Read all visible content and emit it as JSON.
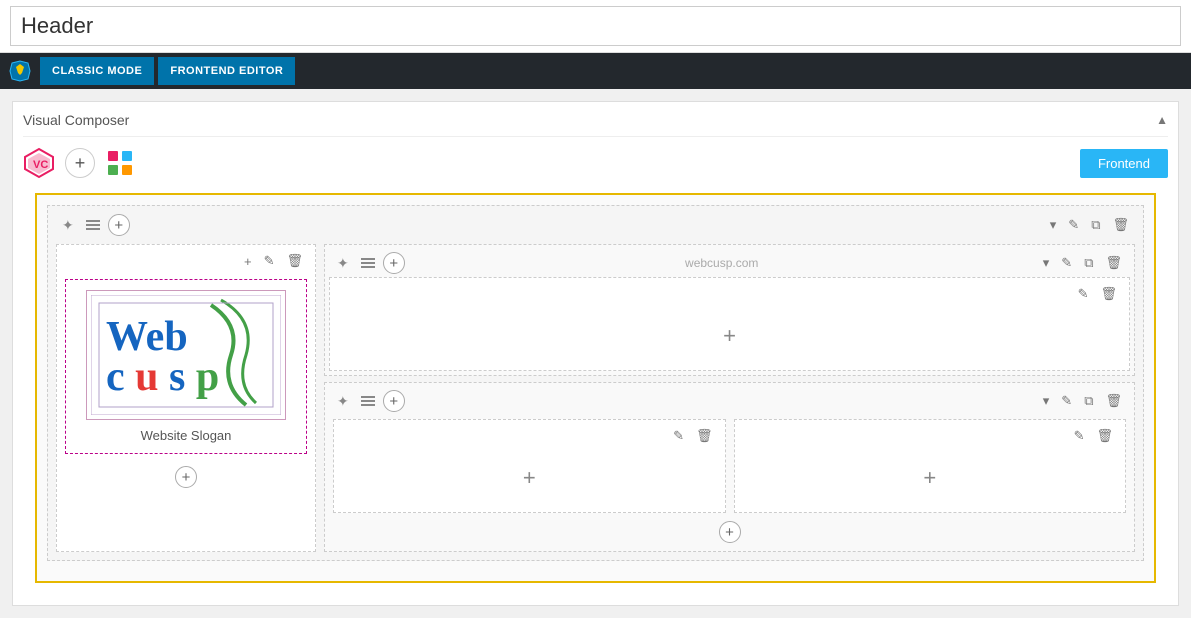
{
  "top_bar": {
    "title_value": "Header",
    "title_placeholder": "Header"
  },
  "nav": {
    "classic_mode_label": "CLASSIC MODE",
    "frontend_editor_label": "FRONTEND EDITOR"
  },
  "vc_section": {
    "title": "Visual Composer",
    "collapse_arrow": "▲"
  },
  "toolbar": {
    "frontend_btn_label": "Frontend"
  },
  "canvas": {
    "webcusp_label": "webcusp.com",
    "slogan_label": "Website Slogan",
    "rows": [
      {
        "id": "row1",
        "columns": [
          "col-left",
          "col-right"
        ]
      }
    ]
  },
  "icons": {
    "drag": "✦",
    "plus": "+",
    "pencil": "✎",
    "trash": "🗑",
    "copy": "⧉",
    "chevron": "▾",
    "hamburger": "≡"
  }
}
